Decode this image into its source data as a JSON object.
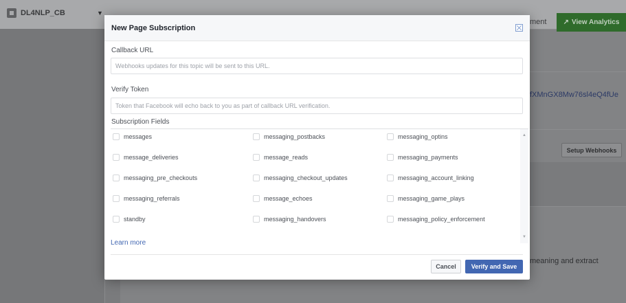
{
  "background": {
    "app_name": "DL4NLP_CB",
    "nav_text_partial": "ment",
    "analytics_button": "View Analytics",
    "token_partial": "fXMnGX8Mw76sl4eQ4fUe",
    "setup_button": "Setup Webhooks",
    "description_partial": "meaning and extract"
  },
  "modal": {
    "title": "New Page Subscription",
    "callback_label": "Callback URL",
    "callback_placeholder": "Webhooks updates for this topic will be sent to this URL.",
    "callback_value": "",
    "verify_label": "Verify Token",
    "verify_placeholder": "Token that Facebook will echo back to you as part of callback URL verification.",
    "verify_value": "",
    "fields_label": "Subscription Fields",
    "fields": [
      [
        "messages",
        "messaging_postbacks",
        "messaging_optins"
      ],
      [
        "message_deliveries",
        "message_reads",
        "messaging_payments"
      ],
      [
        "messaging_pre_checkouts",
        "messaging_checkout_updates",
        "messaging_account_linking"
      ],
      [
        "messaging_referrals",
        "message_echoes",
        "messaging_game_plays"
      ],
      [
        "standby",
        "messaging_handovers",
        "messaging_policy_enforcement"
      ]
    ],
    "learn_more": "Learn more",
    "cancel_button": "Cancel",
    "save_button": "Verify and Save"
  },
  "colors": {
    "primary": "#4267b2",
    "analytics_green": "#42b72a"
  },
  "icons": {
    "close": "close-icon",
    "checkbox": "checkbox-icon",
    "analytics": "trend-up-icon"
  }
}
